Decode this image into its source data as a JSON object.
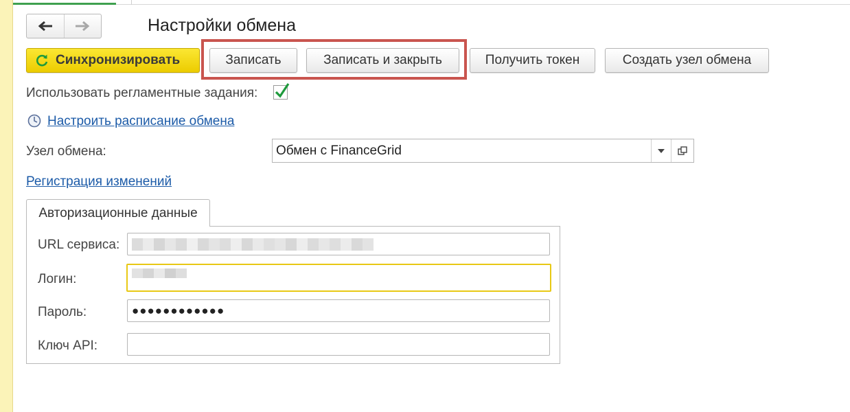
{
  "window": {
    "title": "Настройки обмена"
  },
  "nav": {
    "back_icon": "arrow-left-icon",
    "forward_icon": "arrow-right-icon"
  },
  "toolbar": {
    "sync_label": "Синхронизировать",
    "sync_icon": "refresh-icon",
    "save_label": "Записать",
    "save_close_label": "Записать и закрыть",
    "get_token_label": "Получить токен",
    "create_node_label": "Создать узел обмена"
  },
  "settings": {
    "use_scheduled_tasks_label": "Использовать регламентные задания:",
    "use_scheduled_tasks_checked": true,
    "schedule_link": "Настроить расписание обмена",
    "exchange_node_label": "Узел обмена:",
    "exchange_node_value": "Обмен с FinanceGrid",
    "register_changes_link": "Регистрация изменений"
  },
  "auth_tab": {
    "tab_label": "Авторизационные данные",
    "url_label": "URL сервиса:",
    "login_label": "Логин:",
    "password_label": "Пароль:",
    "password_value": "●●●●●●●●●●●●",
    "api_key_label": "Ключ API:",
    "api_key_value": ""
  },
  "colors": {
    "accent_yellow": "#f5dd1a",
    "highlight_red": "#c9554f",
    "link_blue": "#1c5ba8",
    "check_green": "#1e9a3c",
    "focus_yellow": "#e8c814"
  }
}
